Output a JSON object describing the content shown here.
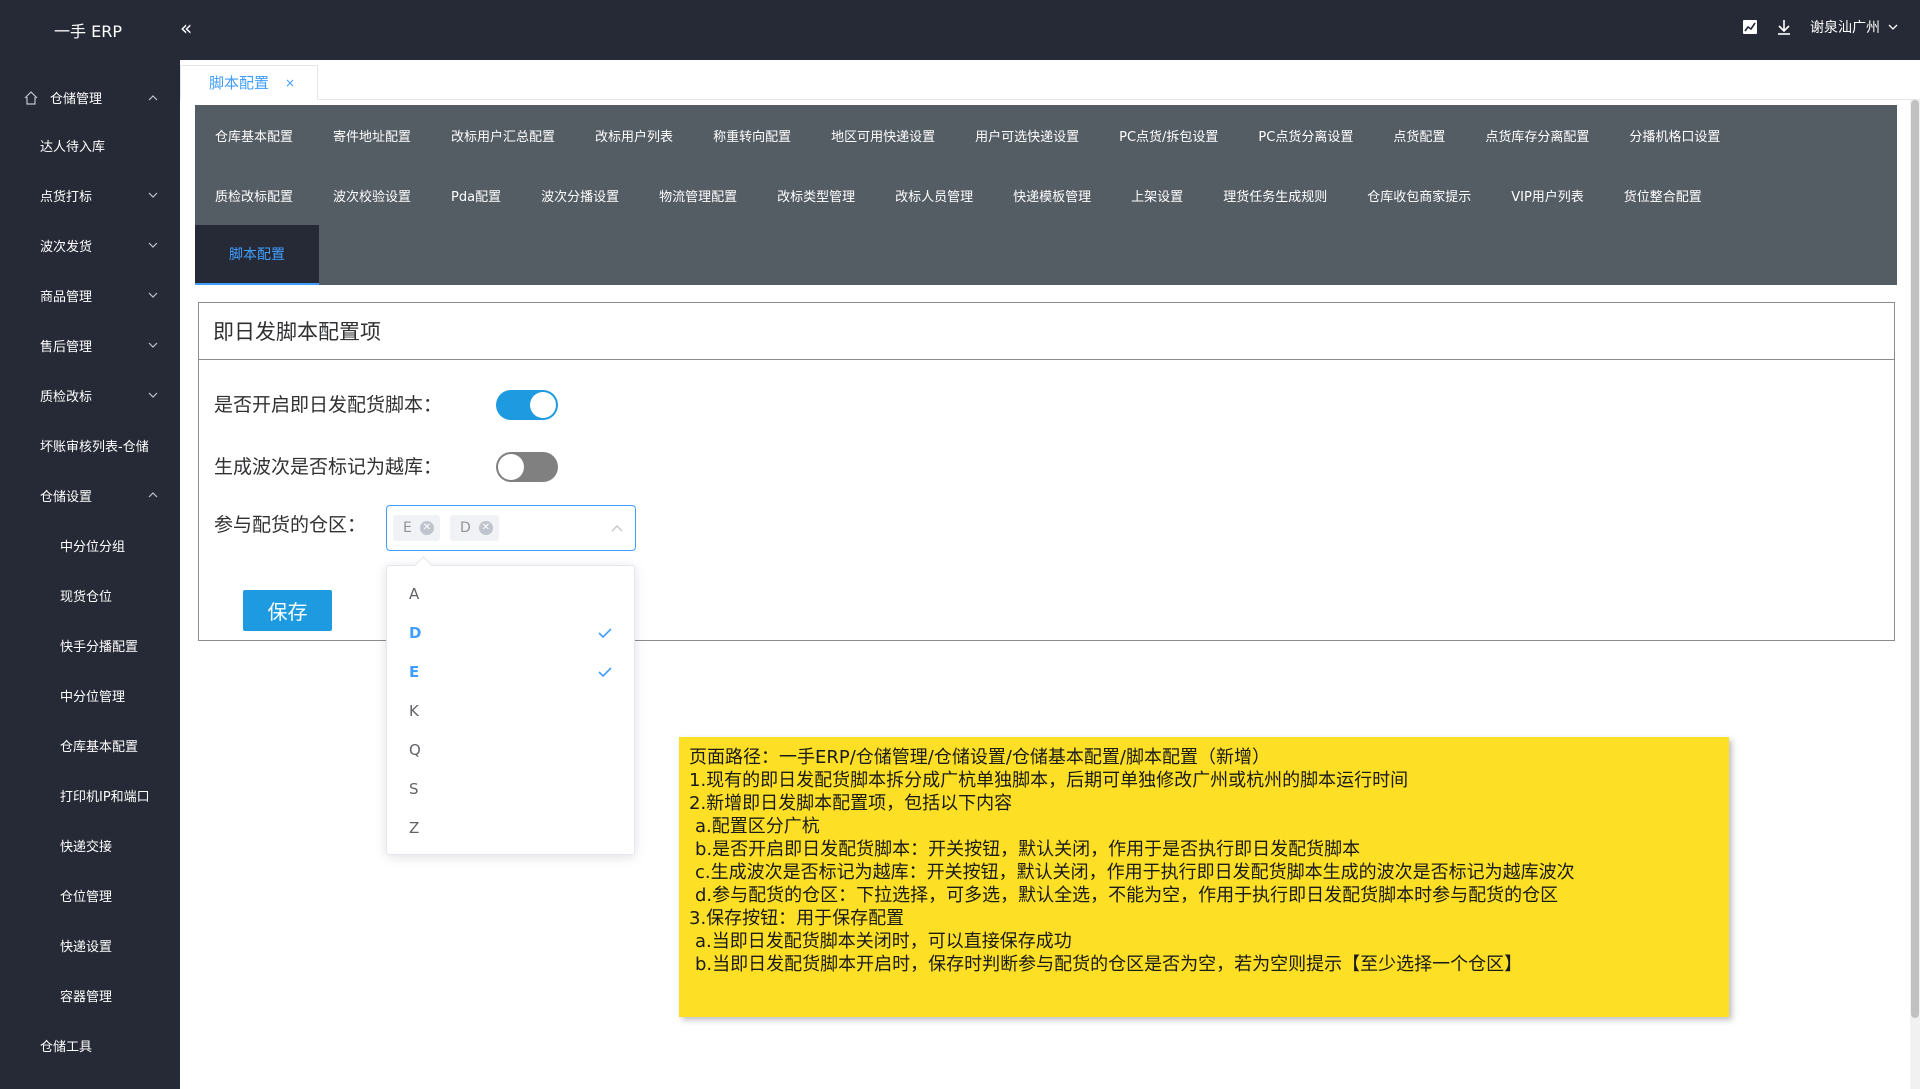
{
  "app": {
    "title": "一手 ERP"
  },
  "topbar": {
    "user": "谢泉汕广州"
  },
  "sidebar": {
    "items": [
      {
        "label": "仓储管理",
        "expanded": true
      },
      {
        "label": "达人待入库"
      },
      {
        "label": "点货打标"
      },
      {
        "label": "波次发货"
      },
      {
        "label": "商品管理"
      },
      {
        "label": "售后管理"
      },
      {
        "label": "质检改标"
      },
      {
        "label": "坏账审核列表-仓储"
      },
      {
        "label": "仓储设置",
        "expanded": true
      },
      {
        "label": "中分位分组"
      },
      {
        "label": "现货仓位"
      },
      {
        "label": "快手分播配置"
      },
      {
        "label": "中分位管理"
      },
      {
        "label": "仓库基本配置"
      },
      {
        "label": "打印机IP和端口"
      },
      {
        "label": "快递交接"
      },
      {
        "label": "仓位管理"
      },
      {
        "label": "快递设置"
      },
      {
        "label": "容器管理"
      },
      {
        "label": "仓储工具"
      }
    ]
  },
  "tabs": [
    {
      "label": "脚本配置",
      "close": "×"
    }
  ],
  "config_nav": {
    "row1": [
      "仓库基本配置",
      "寄件地址配置",
      "改标用户汇总配置",
      "改标用户列表",
      "称重转向配置",
      "地区可用快递设置",
      "用户可选快递设置",
      "PC点货/拆包设置",
      "PC点货分离设置",
      "点货配置",
      "点货库存分离配置",
      "分播机格口设置"
    ],
    "row2": [
      "质检改标配置",
      "波次校验设置",
      "Pda配置",
      "波次分播设置",
      "物流管理配置",
      "改标类型管理",
      "改标人员管理",
      "快递模板管理",
      "上架设置",
      "理货任务生成规则",
      "仓库收包商家提示",
      "VIP用户列表",
      "货位整合配置"
    ],
    "active": "脚本配置"
  },
  "form": {
    "title": "即日发脚本配置项",
    "enable_label": "是否开启即日发配货脚本：",
    "enable_value": true,
    "overflow_label": "生成波次是否标记为越库：",
    "overflow_value": false,
    "zone_label": "参与配货的仓区：",
    "zone_selected": [
      "E",
      "D"
    ],
    "save_label": "保存"
  },
  "dropdown": {
    "options": [
      {
        "label": "A",
        "selected": false
      },
      {
        "label": "D",
        "selected": true
      },
      {
        "label": "E",
        "selected": true
      },
      {
        "label": "K",
        "selected": false
      },
      {
        "label": "Q",
        "selected": false
      },
      {
        "label": "S",
        "selected": false
      },
      {
        "label": "Z",
        "selected": false
      }
    ]
  },
  "note": {
    "lines": [
      "页面路径：一手ERP/仓储管理/仓储设置/仓储基本配置/脚本配置（新增）",
      "1.现有的即日发配货脚本拆分成广杭单独脚本，后期可单独修改广州或杭州的脚本运行时间",
      "2.新增即日发脚本配置项，包括以下内容",
      "a.配置区分广杭",
      "b.是否开启即日发配货脚本：开关按钮，默认关闭，作用于是否执行即日发配货脚本",
      "c.生成波次是否标记为越库：开关按钮，默认关闭，作用于执行即日发配货脚本生成的波次是否标记为越库波次",
      "d.参与配货的仓区：下拉选择，可多选，默认全选，不能为空，作用于执行即日发配货脚本时参与配货的仓区",
      "3.保存按钮：用于保存配置",
      "a.当即日发配货脚本关闭时，可以直接保存成功",
      "b.当即日发配货脚本开启时，保存时判断参与配货的仓区是否为空，若为空则提示【至少选择一个仓区】"
    ]
  },
  "colors": {
    "sidebar_bg": "#262a36",
    "nav_bg": "#545c64",
    "accent": "#409eff",
    "switch_on": "#1e9be0",
    "note_bg": "#fde025"
  }
}
